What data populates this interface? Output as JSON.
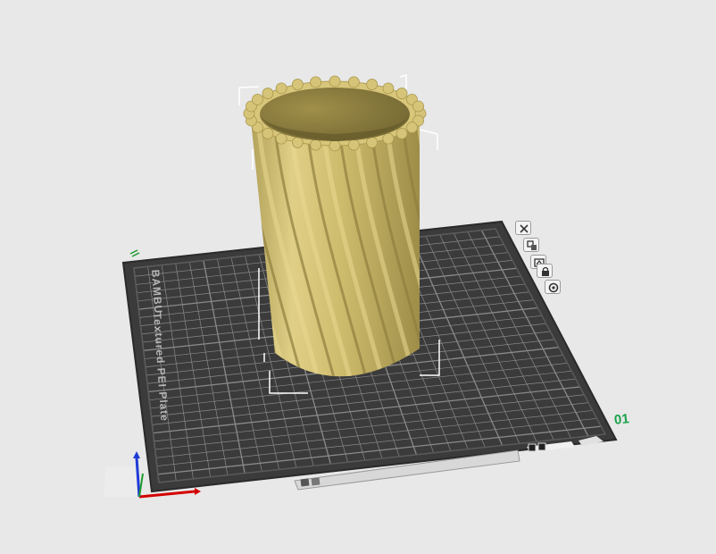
{
  "app": "Bambu Studio - 3D prepare view",
  "plate": {
    "number": "01",
    "brand_text": "BAMBU",
    "surface_text": "Textured PEI Plate"
  },
  "plate_tools": [
    {
      "name": "close-plate",
      "icon": "x-icon"
    },
    {
      "name": "arrange-plate",
      "icon": "arrange-icon"
    },
    {
      "name": "orient-plate",
      "icon": "orient-icon"
    },
    {
      "name": "lock-plate",
      "icon": "lock-icon"
    },
    {
      "name": "plate-settings",
      "icon": "gear-icon"
    }
  ],
  "model": {
    "type": "twisted fluted vase",
    "color": "#c9b76a"
  },
  "colors": {
    "background": "#e8e8e8",
    "plate": "#3b3b3b",
    "grid": "#8a8a8a",
    "plate_number": "#1aa34a",
    "model": "#c9b76a",
    "axis_x": "#d40000",
    "axis_y": "#1e9a2e",
    "axis_z": "#1f3bd6"
  }
}
